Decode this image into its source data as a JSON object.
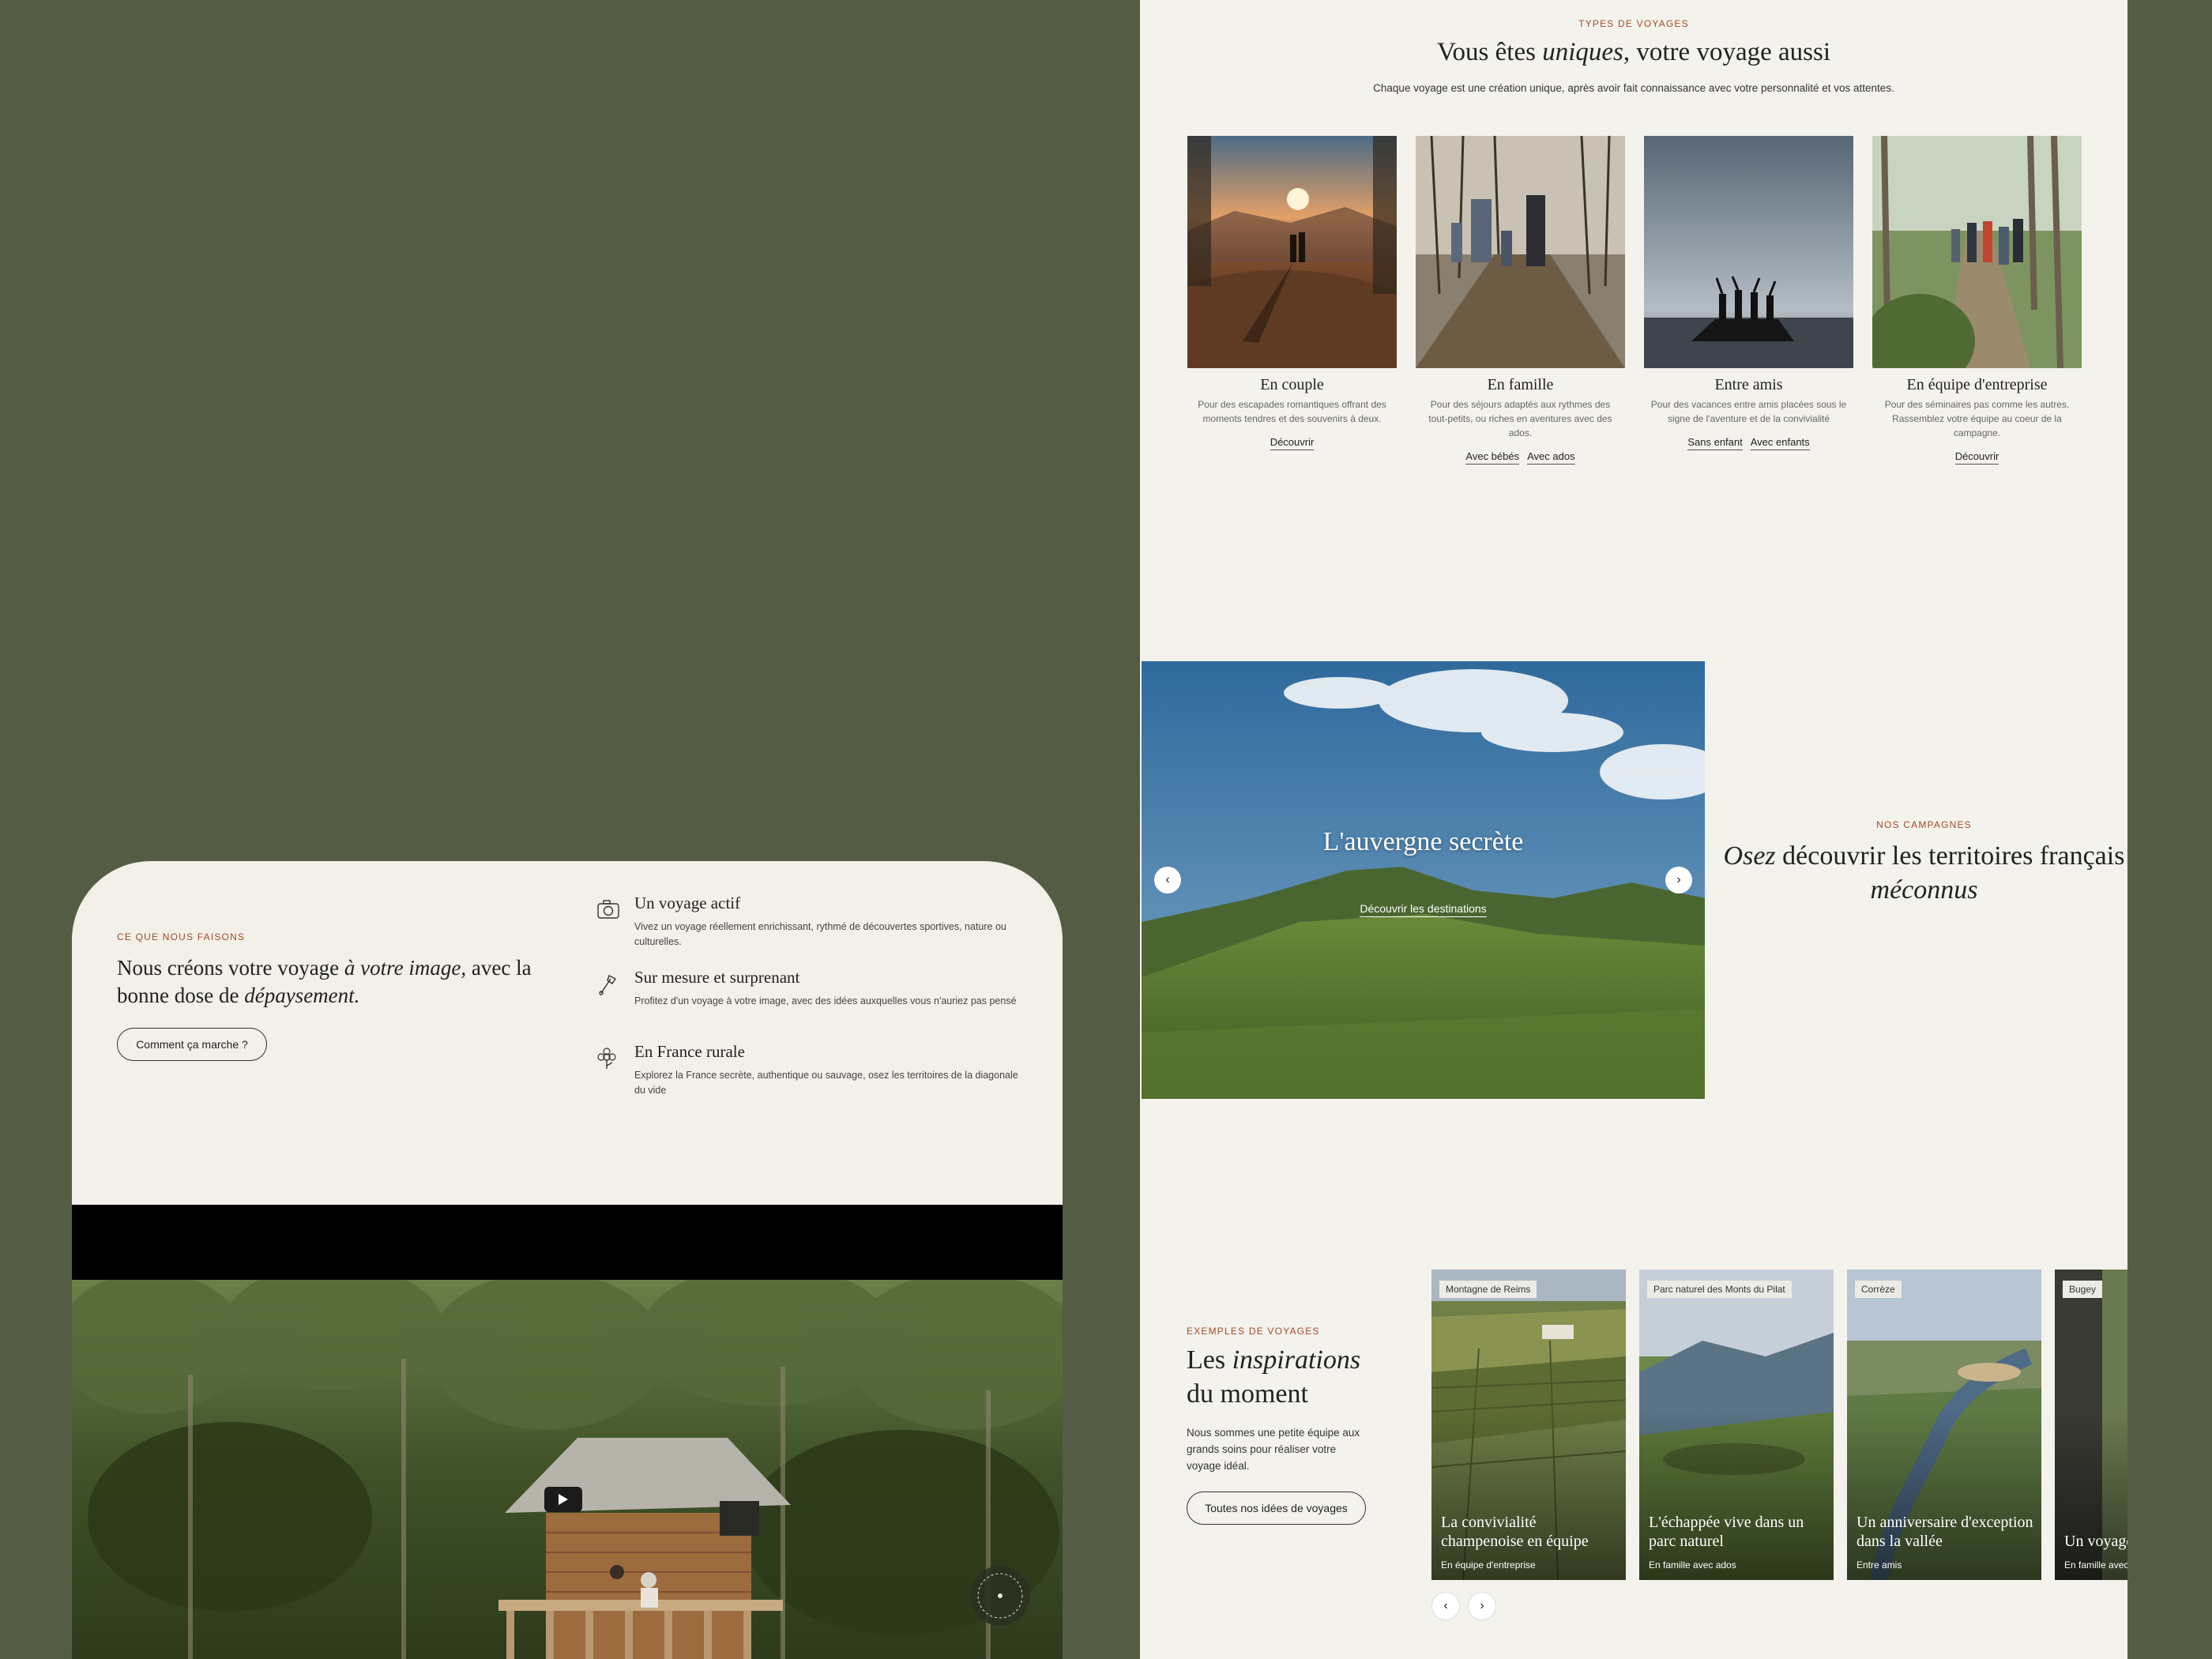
{
  "left_card": {
    "eyebrow": "CE QUE NOUS FAISONS",
    "title_1": "Nous créons votre voyage ",
    "title_2": "à votre image,",
    "title_3": " avec la bonne dose de ",
    "title_4": "dépaysement.",
    "button": "Comment ça marche ?",
    "features": [
      {
        "icon": "camera-icon",
        "title": "Un voyage actif",
        "desc": "Vivez un voyage réellement enrichissant, rythmé de découvertes sportives, nature ou culturelles."
      },
      {
        "icon": "tool-icon",
        "title": "Sur mesure et surprenant",
        "desc": "Profitez d'un voyage à votre image, avec des idées auxquelles vous n'auriez pas pensé"
      },
      {
        "icon": "flower-icon",
        "title": "En France rurale",
        "desc": "Explorez la France secrète, authentique ou sauvage, osez les territoires de la diagonale du vide"
      }
    ],
    "play_icon": "play-icon",
    "badge_icon": "rotating-badge-icon"
  },
  "types": {
    "eyebrow": "TYPES DE VOYAGES",
    "title_1": "Vous êtes ",
    "title_2": "uniques",
    "title_3": ", votre voyage aussi",
    "subtitle": "Chaque voyage est une création unique, après avoir fait connaissance avec votre personnalité et vos attentes.",
    "cards": [
      {
        "title": "En couple",
        "desc": "Pour des escapades romantiques offrant des moments tendres et des souvenirs à deux.",
        "links": [
          "Découvrir"
        ]
      },
      {
        "title": "En famille",
        "desc": "Pour des séjours adaptés aux rythmes des tout-petits, ou riches en aventures avec des ados.",
        "links": [
          "Avec bébés",
          "Avec ados"
        ]
      },
      {
        "title": "Entre amis",
        "desc": "Pour des vacances entre amis placées sous le signe de l'aventure et de la convivialité",
        "links": [
          "Sans enfant",
          "Avec enfants"
        ]
      },
      {
        "title": "En équipe d'entreprise",
        "desc": "Pour des séminaires pas comme les autres. Rassemblez votre équipe au coeur de la campagne.",
        "links": [
          "Découvrir"
        ]
      }
    ]
  },
  "hero": {
    "title": "L'auvergne secrète",
    "link": "Découvrir les destinations",
    "prev": "‹",
    "next": "›"
  },
  "campagnes": {
    "eyebrow": "NOS CAMPAGNES",
    "title_1": "Osez",
    "title_2": " découvrir les territoires français ",
    "title_3": "méconnus"
  },
  "inspirations": {
    "eyebrow": "EXEMPLES DE VOYAGES",
    "title_1": "Les ",
    "title_2": "inspirations",
    "title_3": " du moment",
    "desc": "Nous sommes une petite équipe aux grands soins pour réaliser votre voyage idéal.",
    "button": "Toutes nos idées de voyages",
    "cards": [
      {
        "tag": "Montagne de Reims",
        "title": "La convivialité champenoise en équipe",
        "sub": "En équipe d'entreprise"
      },
      {
        "tag": "Parc naturel des Monts du Pilat",
        "title": "L'échappée vive dans un parc naturel",
        "sub": "En famille avec ados"
      },
      {
        "tag": "Corrèze",
        "title": "Un anniversaire d'exception dans la vallée",
        "sub": "Entre amis"
      },
      {
        "tag": "Bugey",
        "title": "Un voyage aux pieds",
        "sub": "En famille avec"
      }
    ],
    "prev": "‹",
    "next": "›"
  }
}
